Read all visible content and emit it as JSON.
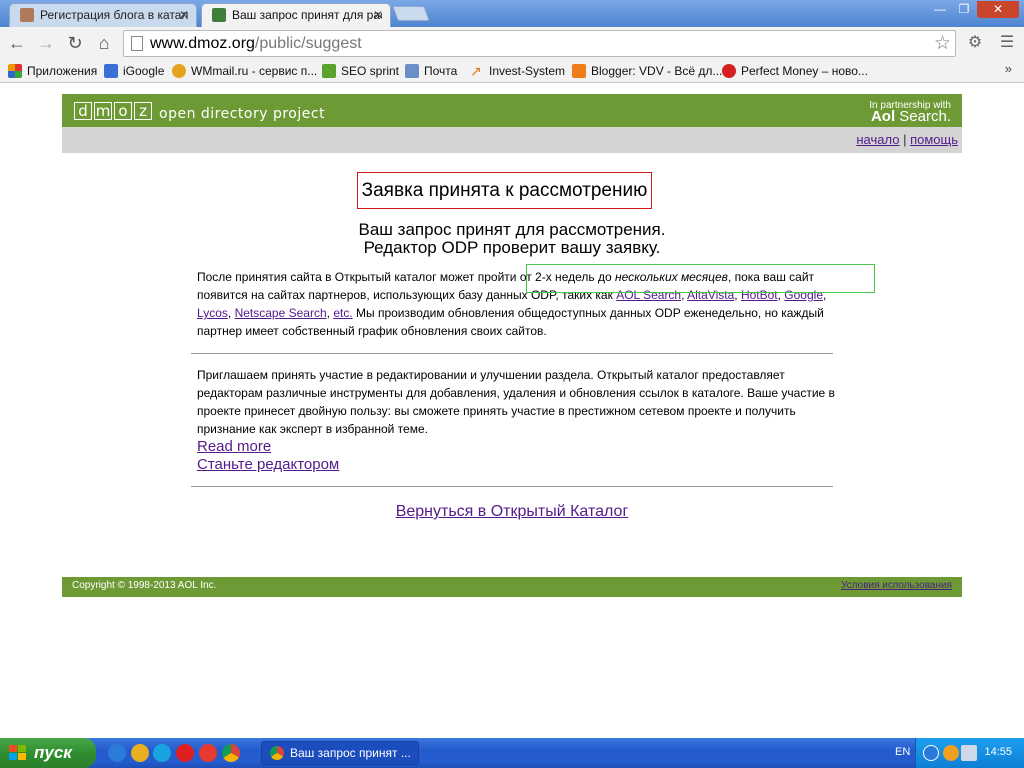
{
  "browser": {
    "tabs": [
      {
        "label": "Регистрация блога в катал",
        "active": false
      },
      {
        "label": "Ваш запрос принят для рас",
        "active": true
      }
    ],
    "close_glyph": "✕",
    "window_controls": {
      "minimize": "—",
      "restore": "❐",
      "close": "✕"
    },
    "url": {
      "domain": "www.dmoz.org",
      "path": "/public/suggest"
    },
    "bookmarks": [
      {
        "label": "Приложения",
        "color": "#d33"
      },
      {
        "label": "iGoogle",
        "color": "#3a6fd8"
      },
      {
        "label": "WMmail.ru - сервис п...",
        "color": "#e5a21f"
      },
      {
        "label": "SEO sprint",
        "color": "#5aa12e"
      },
      {
        "label": "Почта",
        "color": "#6b8fc9"
      },
      {
        "label": "Invest-System",
        "color": "#e07a1e"
      },
      {
        "label": "Blogger: VDV - Всё дл...",
        "color": "#f07b1b"
      },
      {
        "label": "Perfect Money – ново...",
        "color": "#d62020"
      }
    ],
    "bookmarks_more": "»"
  },
  "page": {
    "logo_letters": [
      "d",
      "m",
      "o",
      "z"
    ],
    "logo_sub": "open directory project",
    "partner_line": "In partnership with",
    "partner_brand": "Aol",
    "partner_search": "Search.",
    "nav_home": "начало",
    "nav_sep": "|",
    "nav_help": "помощь",
    "title": "Заявка принята к рассмотрению",
    "confirm_line1": "Ваш запрос принят для рассмотрения.",
    "confirm_line2": "Редактор ODP проверит вашу заявку.",
    "p1_a": "После принятия сайта в Открытый каталог может пройти от 2-х недель до ",
    "p1_em": "нескольких месяцев",
    "p1_b": ", пока ваш сайт появится на сайтах партнеров, использующих базу данных ODP, таких как ",
    "partners": [
      "AOL Search",
      "AltaVista",
      "HotBot",
      "Google",
      "Lycos",
      "Netscape Search",
      "etc."
    ],
    "p1_c": " Мы производим обновления общедоступных данных ODP еженедельно, но каждый партнер имеет собственный график обновления своих сайтов.",
    "p2": "Приглашаем принять участие в редактировании и улучшении раздела. Открытый каталог предоставляет редакторам различные инструменты для добавления, удаления и обновления ссылок в каталоге. Ваше участие в проекте принесет двойную пользу: вы сможете принять участие в престижном сетевом проекте и получить признание как эксперт в избранной теме.",
    "read_more": "Read more",
    "become_editor": "Станьте редактором",
    "return_link": "Вернуться в Открытый Каталог",
    "copyright": "Copyright © 1998-2013 AOL Inc.",
    "terms": "Условия использования",
    "header_green": "#6e9a35"
  },
  "taskbar": {
    "start": "пуск",
    "window_title": "Ваш запрос принят ...",
    "lang": "EN",
    "clock": "14:55"
  }
}
